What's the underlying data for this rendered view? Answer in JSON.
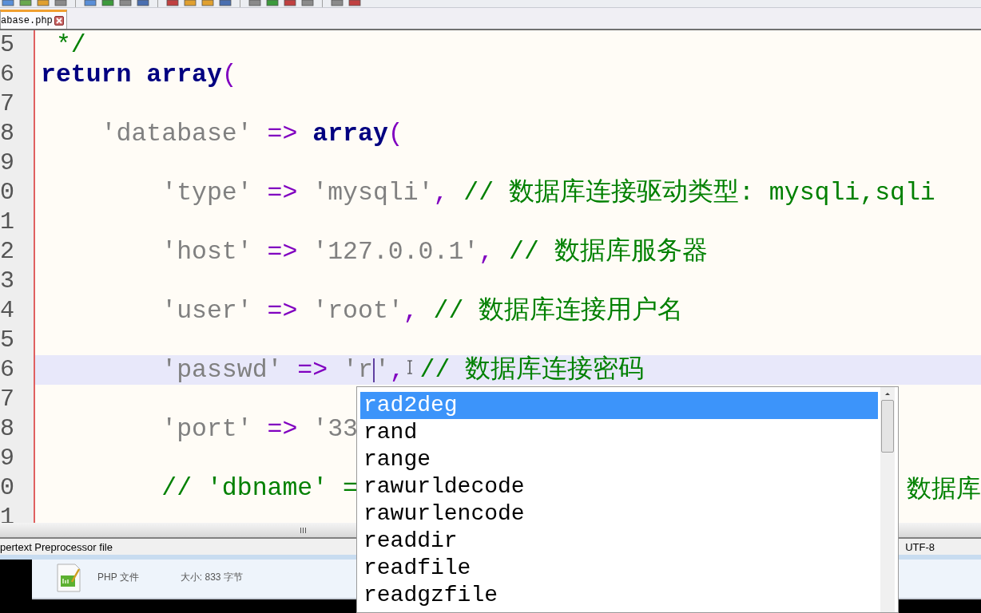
{
  "tab": {
    "label": "abase.php",
    "selected": true
  },
  "editor": {
    "lines": [
      {
        "number": "5",
        "current": false,
        "tokens": [
          {
            "kind": "comment",
            "text": " */"
          }
        ]
      },
      {
        "number": "6",
        "current": false,
        "tokens": [
          {
            "kind": "keyword",
            "text": "return array"
          },
          {
            "kind": "paren",
            "text": "("
          }
        ]
      },
      {
        "number": "7",
        "current": false
      },
      {
        "number": "8",
        "current": false,
        "tokens": [
          {
            "kind": "string",
            "text": "    'database'"
          },
          {
            "kind": "operator",
            "text": " => "
          },
          {
            "kind": "keyword",
            "text": "array"
          },
          {
            "kind": "paren",
            "text": "("
          }
        ]
      },
      {
        "number": "9",
        "current": false
      },
      {
        "number": "0",
        "current": false,
        "tokens": [
          {
            "kind": "string",
            "text": "        'type'"
          },
          {
            "kind": "operator",
            "text": " => "
          },
          {
            "kind": "string",
            "text": "'mysqli'"
          },
          {
            "kind": "operator",
            "text": ", "
          },
          {
            "kind": "comment",
            "text": "// 数据库连接驱动类型: mysqli,sqli"
          }
        ]
      },
      {
        "number": "1",
        "current": false
      },
      {
        "number": "2",
        "current": false,
        "tokens": [
          {
            "kind": "string",
            "text": "        'host'"
          },
          {
            "kind": "operator",
            "text": " => "
          },
          {
            "kind": "string",
            "text": "'127.0.0.1'"
          },
          {
            "kind": "operator",
            "text": ", "
          },
          {
            "kind": "comment",
            "text": "// 数据库服务器"
          }
        ]
      },
      {
        "number": "3",
        "current": false
      },
      {
        "number": "4",
        "current": false,
        "tokens": [
          {
            "kind": "string",
            "text": "        'user'"
          },
          {
            "kind": "operator",
            "text": " => "
          },
          {
            "kind": "string",
            "text": "'root'"
          },
          {
            "kind": "operator",
            "text": ", "
          },
          {
            "kind": "comment",
            "text": "// 数据库连接用户名"
          }
        ]
      },
      {
        "number": "5",
        "current": false
      },
      {
        "number": "6",
        "current": true,
        "tokens": [
          {
            "kind": "string",
            "text": "        'passwd'"
          },
          {
            "kind": "operator",
            "text": " => "
          },
          {
            "kind": "string",
            "text": "'r"
          },
          {
            "kind": "caret"
          },
          {
            "kind": "string",
            "text": "'"
          },
          {
            "kind": "operator",
            "text": ", "
          },
          {
            "kind": "comment",
            "text": "// 数据库连接密码"
          }
        ]
      },
      {
        "number": "7",
        "current": false
      },
      {
        "number": "8",
        "current": false,
        "tokens": [
          {
            "kind": "string",
            "text": "        'port'"
          },
          {
            "kind": "operator",
            "text": " => "
          },
          {
            "kind": "string",
            "text": "'33"
          }
        ]
      },
      {
        "number": "9",
        "current": false
      },
      {
        "number": "0",
        "current": false,
        "tokens": [
          {
            "kind": "comment",
            "text": "        // 'dbname' ="
          }
        ],
        "tail": "数据库"
      },
      {
        "number": "1",
        "current": false
      }
    ]
  },
  "autocomplete": {
    "items": [
      {
        "label": "rad2deg",
        "selected": true
      },
      {
        "label": "rand",
        "selected": false
      },
      {
        "label": "range",
        "selected": false
      },
      {
        "label": "rawurldecode",
        "selected": false
      },
      {
        "label": "rawurlencode",
        "selected": false
      },
      {
        "label": "readdir",
        "selected": false
      },
      {
        "label": "readfile",
        "selected": false
      },
      {
        "label": "readgzfile",
        "selected": false
      }
    ]
  },
  "status_bar": {
    "file_type": "pertext Preprocessor file",
    "encoding": "UTF-8"
  },
  "file_details": {
    "type": "PHP 文件",
    "size": "大小: 833 字节"
  }
}
